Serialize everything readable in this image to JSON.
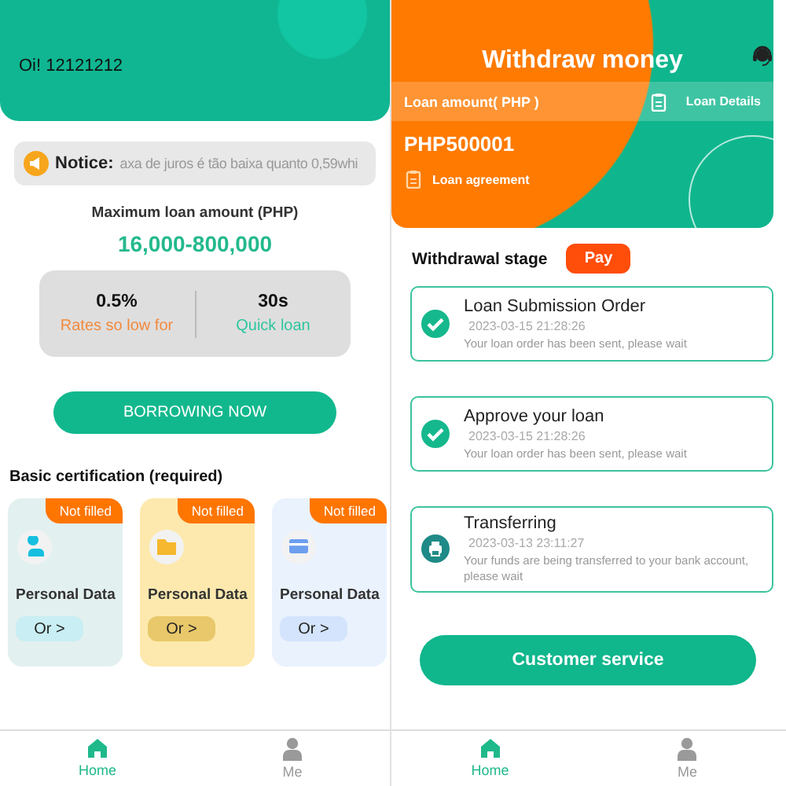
{
  "home": {
    "greeting": "Oi!  12121212",
    "notice": {
      "label": "Notice:",
      "text": "axa de juros é tão baixa quanto 0,59whi"
    },
    "max_loan": {
      "label": "Maximum loan amount (PHP)",
      "amount": "16,000-800,000"
    },
    "stats": [
      {
        "value": "0.5%",
        "caption": "Rates so low for",
        "kind": "rate"
      },
      {
        "value": "30s",
        "caption": "Quick loan",
        "kind": "speed"
      }
    ],
    "borrow_button": "BORROWING NOW",
    "certification": {
      "title": "Basic certification (required)",
      "cards": [
        {
          "kind": "person",
          "badge": "Not filled",
          "title": "Personal Data",
          "button": "Or >"
        },
        {
          "kind": "folder",
          "badge": "Not filled",
          "title": "Personal Data",
          "button": "Or >"
        },
        {
          "kind": "card",
          "badge": "Not filled",
          "title": "Personal Data",
          "button": "Or >"
        }
      ]
    },
    "nav": [
      {
        "label": "Home",
        "kind": "home",
        "selected": true
      },
      {
        "label": "Me",
        "kind": "me",
        "selected": false
      }
    ]
  },
  "withdraw": {
    "title": "Withdraw money",
    "loan_amount_label": "Loan amount( PHP )",
    "loan_details": "Loan Details",
    "amount": "PHP500001",
    "agreement": "Loan agreement",
    "stage": {
      "label": "Withdrawal stage",
      "badge": "Pay"
    },
    "steps": [
      {
        "title": "Loan Submission Order",
        "time": "2023-03-15 21:28:26",
        "message": "Your loan order has been sent, please wait",
        "done": true
      },
      {
        "title": "Approve your loan",
        "time": "2023-03-15 21:28:26",
        "message": "Your loan order has been sent, please wait",
        "done": true
      },
      {
        "title": "Transferring",
        "time": "2023-03-13 23:11:27",
        "message": "Your funds are being transferred to your bank account, please wait",
        "done": false
      }
    ],
    "service_button": "Customer service",
    "nav": [
      {
        "label": "Home",
        "kind": "home",
        "selected": true
      },
      {
        "label": "Me",
        "kind": "me",
        "selected": false
      }
    ]
  }
}
